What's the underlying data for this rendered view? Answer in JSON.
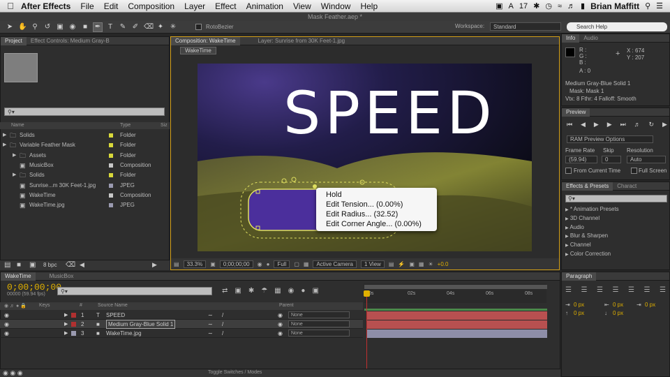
{
  "menubar": {
    "app": "After Effects",
    "items": [
      "File",
      "Edit",
      "Composition",
      "Layer",
      "Effect",
      "Animation",
      "View",
      "Window",
      "Help"
    ],
    "status": "17",
    "user": "Brian Maffitt"
  },
  "window": {
    "title": "Mask Feather.aep *"
  },
  "toolbar": {
    "rotobezier": "RotoBezier",
    "workspace_label": "Workspace:",
    "workspace": "Standard",
    "search_help": "Search Help"
  },
  "project": {
    "tab": "Project",
    "tab2": "Effect Controls: Medium Gray-B",
    "search": "",
    "headers": {
      "name": "Name",
      "type": "Type",
      "size": "Siz"
    },
    "items": [
      {
        "name": "Solids",
        "type": "Folder",
        "color": "#d8d83a",
        "indent": 0
      },
      {
        "name": "Variable Feather Mask",
        "type": "Folder",
        "color": "#d8d83a",
        "indent": 0
      },
      {
        "name": "Assets",
        "type": "Folder",
        "color": "#d8d83a",
        "indent": 1
      },
      {
        "name": "MusicBox",
        "type": "Composition",
        "color": "#c8c8c8",
        "indent": 1
      },
      {
        "name": "Solids",
        "type": "Folder",
        "color": "#d8d83a",
        "indent": 1
      },
      {
        "name": "Sunrise...m 30K Feet-1.jpg",
        "type": "JPEG",
        "color": "#9a9ab0",
        "indent": 1
      },
      {
        "name": "WakeTime",
        "type": "Composition",
        "color": "#c8c8c8",
        "indent": 1
      },
      {
        "name": "WakeTime.jpg",
        "type": "JPEG",
        "color": "#9a9ab0",
        "indent": 1
      }
    ],
    "bpc": "8 bpc"
  },
  "comp": {
    "tab": "Composition: WakeTime",
    "layer_tab": "Layer: Sunrise from 30K Feet-1.jpg",
    "button": "WakeTime",
    "speed_text": "SPEED",
    "footer": {
      "zoom": "33.3%",
      "time": "0;00;00;00",
      "res": "Full",
      "camera": "Active Camera",
      "views": "1 View",
      "exposure": "+0.0"
    }
  },
  "context_menu": {
    "items": [
      "Hold",
      "Edit Tension... (0.00%)",
      "Edit Radius... (32.52)",
      "Edit Corner Angle... (0.00%)"
    ]
  },
  "info": {
    "tab": "Info",
    "tab2": "Audio",
    "r": "R :",
    "g": "G :",
    "b": "B :",
    "a": "A : 0",
    "x": "X : 674",
    "y": "Y : 207",
    "line1": "Medium Gray-Blue Solid 1",
    "line2": "Mask: Mask 1",
    "line3": "Vtx: 8 Fthr: 4 Falloff: Smooth"
  },
  "preview": {
    "tab": "Preview",
    "options": "RAM Preview Options",
    "frame_rate_label": "Frame Rate",
    "skip_label": "Skip",
    "resolution_label": "Resolution",
    "frame_rate": "(59.94)",
    "skip": "0",
    "resolution": "Auto",
    "from_current": "From Current Time",
    "full_screen": "Full Screen"
  },
  "effects": {
    "tab": "Effects & Presets",
    "tab2": "Charact",
    "search": "",
    "items": [
      "* Animation Presets",
      "3D Channel",
      "Audio",
      "Blur & Sharpen",
      "Channel",
      "Color Correction"
    ]
  },
  "paragraph": {
    "tab": "Paragraph",
    "v1": "0 px",
    "v2": "0 px",
    "v3": "0 px",
    "v4": "0 px",
    "v5": "0 px"
  },
  "timeline": {
    "tab": "WakeTime",
    "tab2": "MusicBox",
    "timecode": "0;00;00;00",
    "timecode_sub": "00000 (59.94 fps)",
    "headers": {
      "keys": "Keys",
      "num": "#",
      "source": "Source Name",
      "parent": "Parent"
    },
    "ruler": [
      "0s",
      "02s",
      "04s",
      "06s",
      "08s"
    ],
    "layers": [
      {
        "num": "1",
        "name": "SPEED",
        "parent": "None",
        "color": "#b03030",
        "bar": "#b85050"
      },
      {
        "num": "2",
        "name": "Medium Gray-Blue Solid 1",
        "parent": "None",
        "color": "#b03030",
        "bar": "#b85050"
      },
      {
        "num": "3",
        "name": "WakeTime.jpg",
        "parent": "None",
        "color": "#9a9ab0",
        "bar": "#8e8ea8"
      }
    ],
    "footer": "Toggle Switches / Modes"
  }
}
